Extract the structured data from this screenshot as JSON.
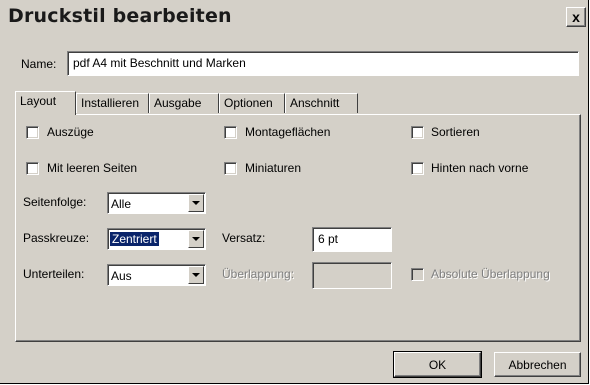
{
  "window": {
    "title": "Druckstil bearbeiten",
    "close_glyph": "x"
  },
  "name_field": {
    "label": "Name:",
    "value": "pdf A4 mit Beschnitt und Marken"
  },
  "tabs": [
    {
      "label": "Layout",
      "active": true
    },
    {
      "label": "Installieren",
      "active": false
    },
    {
      "label": "Ausgabe",
      "active": false
    },
    {
      "label": "Optionen",
      "active": false
    },
    {
      "label": "Anschnitt",
      "active": false
    }
  ],
  "checkboxes": {
    "auszuege": {
      "label": "Auszüge",
      "checked": false
    },
    "montageflaechen": {
      "label": "Montageflächen",
      "checked": false
    },
    "sortieren": {
      "label": "Sortieren",
      "checked": false
    },
    "mit_leeren_seiten": {
      "label": "Mit leeren Seiten",
      "checked": false
    },
    "miniaturen": {
      "label": "Miniaturen",
      "checked": false
    },
    "hinten_nach_vorne": {
      "label": "Hinten nach vorne",
      "checked": false
    },
    "absolute_ueberlappung": {
      "label": "Absolute Überlappung",
      "checked": false,
      "enabled": false
    }
  },
  "seitenfolge": {
    "label": "Seitenfolge:",
    "value": "Alle"
  },
  "passkreuze": {
    "label": "Passkreuze:",
    "value": "Zentriert"
  },
  "unterteilen": {
    "label": "Unterteilen:",
    "value": "Aus"
  },
  "versatz": {
    "label": "Versatz:",
    "value": "6 pt"
  },
  "ueberlappung": {
    "label": "Überlappung:",
    "value": "",
    "enabled": false
  },
  "buttons": {
    "ok": "OK",
    "cancel": "Abbrechen"
  }
}
